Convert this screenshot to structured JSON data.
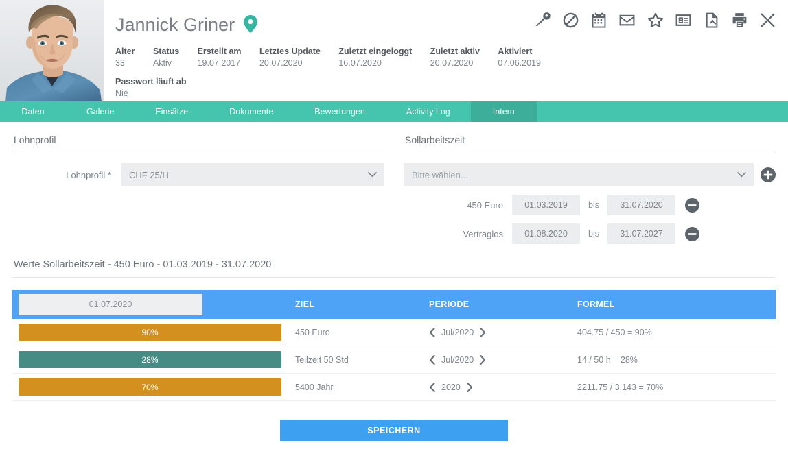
{
  "header": {
    "name": "Jannick Griner",
    "location_icon": "map-pin-icon",
    "avatar_alt": "portrait-photo",
    "meta": [
      {
        "label": "Alter",
        "value": "33"
      },
      {
        "label": "Status",
        "value": "Aktiv"
      },
      {
        "label": "Erstellt am",
        "value": "19.07.2017"
      },
      {
        "label": "Letztes Update",
        "value": "20.07.2020"
      },
      {
        "label": "Zuletzt eingeloggt",
        "value": "16.07.2020"
      },
      {
        "label": "Zuletzt aktiv",
        "value": "20.07.2020"
      },
      {
        "label": "Aktiviert",
        "value": "07.06.2019"
      }
    ],
    "meta2": [
      {
        "label": "Passwort läuft ab",
        "value": "Nie"
      }
    ],
    "toolbar": [
      "key-icon",
      "ban-icon",
      "calendar-icon",
      "envelope-icon",
      "star-icon",
      "id-card-icon",
      "pdf-file-icon",
      "printer-icon",
      "close-icon"
    ]
  },
  "tabs": [
    {
      "label": "Daten",
      "active": false
    },
    {
      "label": "Galerie",
      "active": false
    },
    {
      "label": "Einsätze",
      "active": false
    },
    {
      "label": "Dokumente",
      "active": false
    },
    {
      "label": "Bewertungen",
      "active": false
    },
    {
      "label": "Activity Log",
      "active": false
    },
    {
      "label": "Intern",
      "active": true
    }
  ],
  "lohnprofil": {
    "section_title": "Lohnprofil",
    "field_label": "Lohnprofil *",
    "value": "CHF 25/H"
  },
  "sollarbeitszeit": {
    "section_title": "Sollarbeitszeit",
    "select_placeholder": "Bitte wählen...",
    "add_icon": "plus-circle-icon",
    "rows": [
      {
        "label": "450 Euro",
        "from": "01.03.2019",
        "separator": "bis",
        "to": "31.07.2020",
        "remove_icon": "minus-circle-icon"
      },
      {
        "label": "Vertraglos",
        "from": "01.08.2020",
        "separator": "bis",
        "to": "31.07.2027",
        "remove_icon": "minus-circle-icon"
      }
    ]
  },
  "werte": {
    "title": "Werte Sollarbeitszeit - 450 Euro - 01.03.2019 - 31.07.2020",
    "date_filter": "01.07.2020",
    "columns": {
      "bar": "",
      "ziel": "ZIEL",
      "periode": "PERIODE",
      "formel": "FORMEL"
    },
    "rows": [
      {
        "percent_label": "90%",
        "percent": 90,
        "color": "#d4901f",
        "ziel": "450 Euro",
        "periode": "Jul/2020",
        "formel": "404.75 / 450 = 90%"
      },
      {
        "percent_label": "28%",
        "percent": 28,
        "color": "#468c84",
        "ziel": "Teilzeit 50 Std",
        "periode": "Jul/2020",
        "formel": "14 / 50 h = 28%"
      },
      {
        "percent_label": "70%",
        "percent": 70,
        "color": "#d4901f",
        "ziel": "5400 Jahr",
        "periode": "2020",
        "formel": "2211.75 / 3,143 = 70%"
      }
    ]
  },
  "save": {
    "label": "SPEICHERN"
  },
  "colors": {
    "tab_bar": "#45c5ae",
    "tab_active": "#3cae9a",
    "table_header": "#4fa3f7",
    "save_button": "#3da0f0",
    "bar_orange": "#d4901f",
    "bar_teal": "#468c84"
  }
}
